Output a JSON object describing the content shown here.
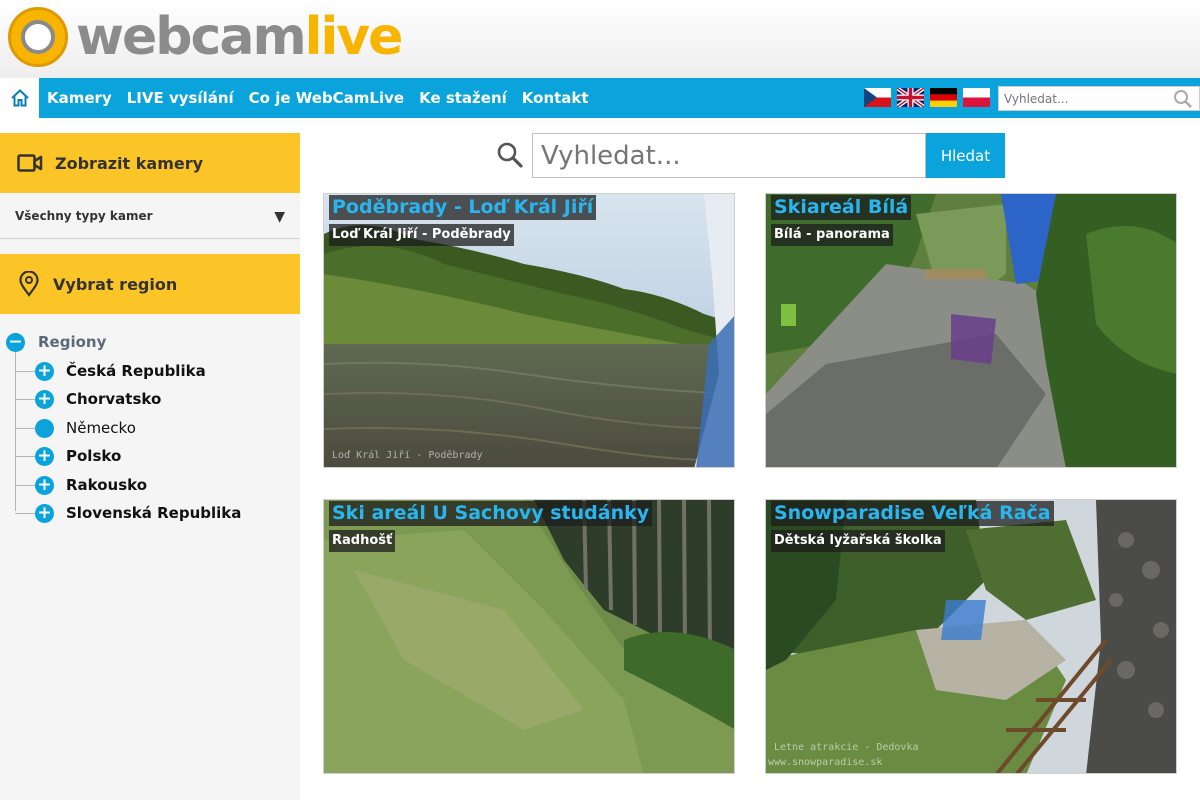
{
  "logo": {
    "part1": "webcam",
    "part2": "live"
  },
  "nav": {
    "items": [
      "Kamery",
      "LIVE vysílání",
      "Co je WebCamLive",
      "Ke stažení",
      "Kontakt"
    ],
    "search_placeholder": "Vyhledat..."
  },
  "sidebar": {
    "cameras_header": "Zobrazit kamery",
    "camera_type_select": "Všechny typy kamer",
    "region_header": "Vybrat region",
    "tree_root": "Regiony",
    "regions": [
      "Česká Republika",
      "Chorvatsko",
      "Německo",
      "Polsko",
      "Rakousko",
      "Slovenská Republika"
    ]
  },
  "search": {
    "placeholder": "Vyhledat...",
    "button": "Hledat"
  },
  "cameras": [
    {
      "title": "Poděbrady - Loď Král Jiří",
      "subtitle": "Loď Král Jiří - Poděbrady",
      "watermark": "Loď Král Jiří - Poděbrady"
    },
    {
      "title": "Skiareál Bílá",
      "subtitle": "Bílá - panorama"
    },
    {
      "title": "Ski areál U Sachovy studánky",
      "subtitle": "Radhošť"
    },
    {
      "title": "Snowparadise Veľká Rača",
      "subtitle": "Dětská lyžařská školka",
      "watermark": "Letne atrakcie - Dedovka",
      "watermark2": "www.snowparadise.sk"
    }
  ],
  "colors": {
    "brand_blue": "#0aa3dc",
    "brand_yellow": "#fcc527",
    "title_blue": "#29b6f0"
  }
}
